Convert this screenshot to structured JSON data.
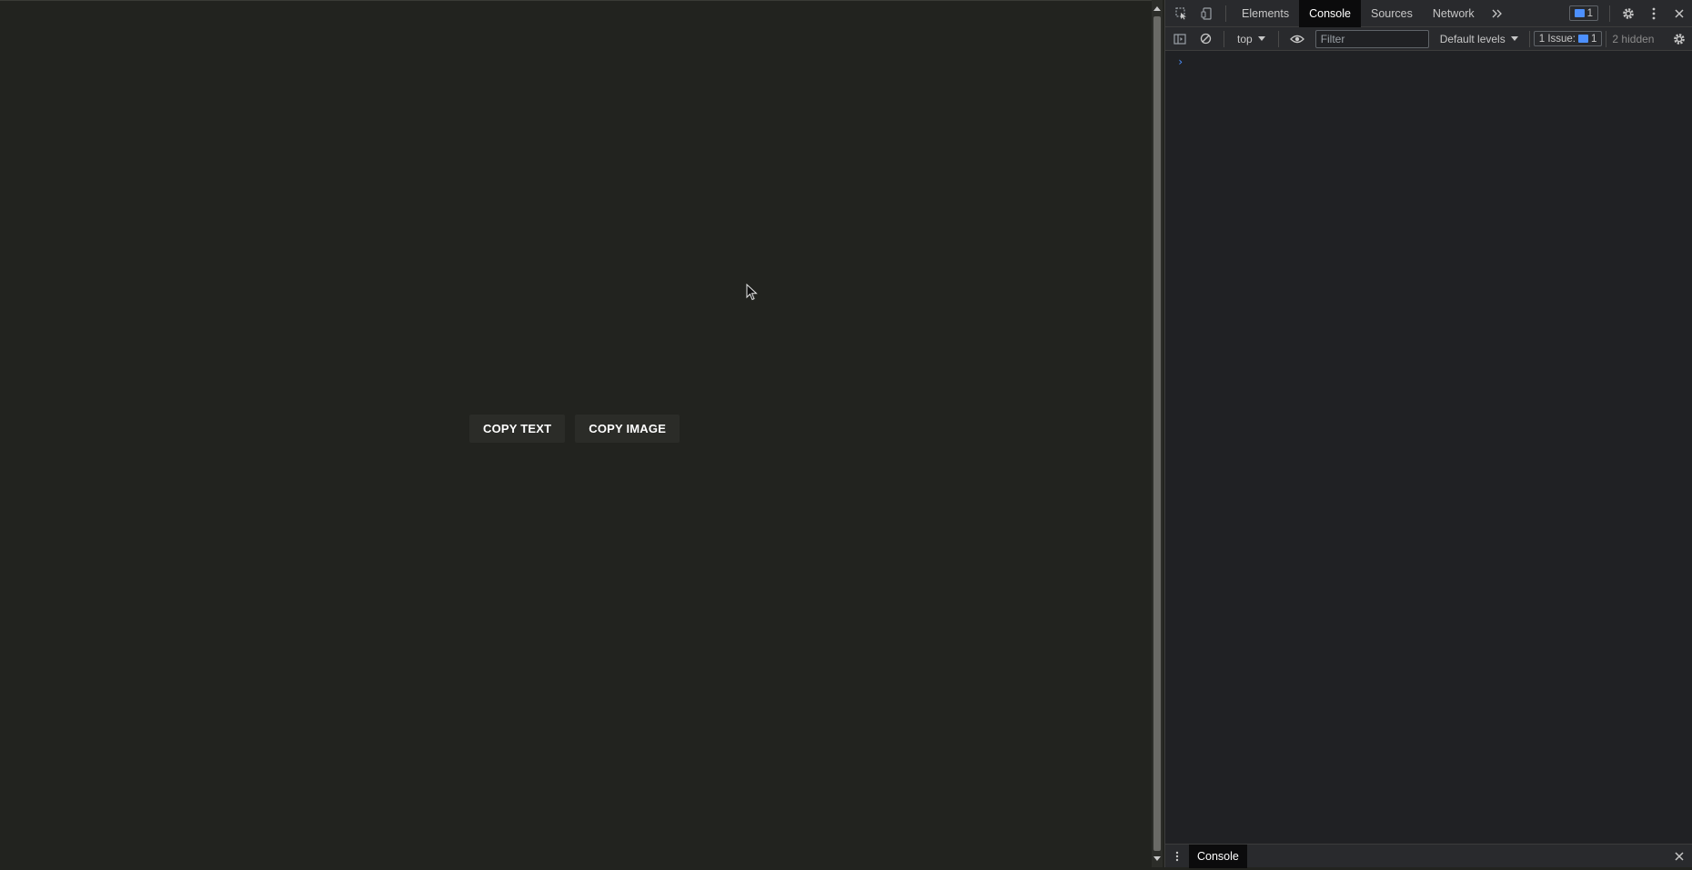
{
  "page": {
    "buttons": [
      {
        "label": "COPY TEXT"
      },
      {
        "label": "COPY IMAGE"
      }
    ]
  },
  "devtools": {
    "tabs": [
      {
        "label": "Elements"
      },
      {
        "label": "Console"
      },
      {
        "label": "Sources"
      },
      {
        "label": "Network"
      }
    ],
    "active_tab": "Console",
    "messages_badge": "1",
    "toolbar": {
      "context": "top",
      "filter_placeholder": "Filter",
      "levels": "Default levels",
      "issues_label": "1 Issue:",
      "issues_count": "1",
      "hidden": "2 hidden"
    },
    "prompt": "›",
    "drawer": {
      "tab_label": "Console"
    }
  },
  "colors": {
    "page_bg": "#22231f",
    "button_bg": "#2b2c28",
    "devtools_bg": "#202124",
    "accent": "#4d90fe"
  }
}
